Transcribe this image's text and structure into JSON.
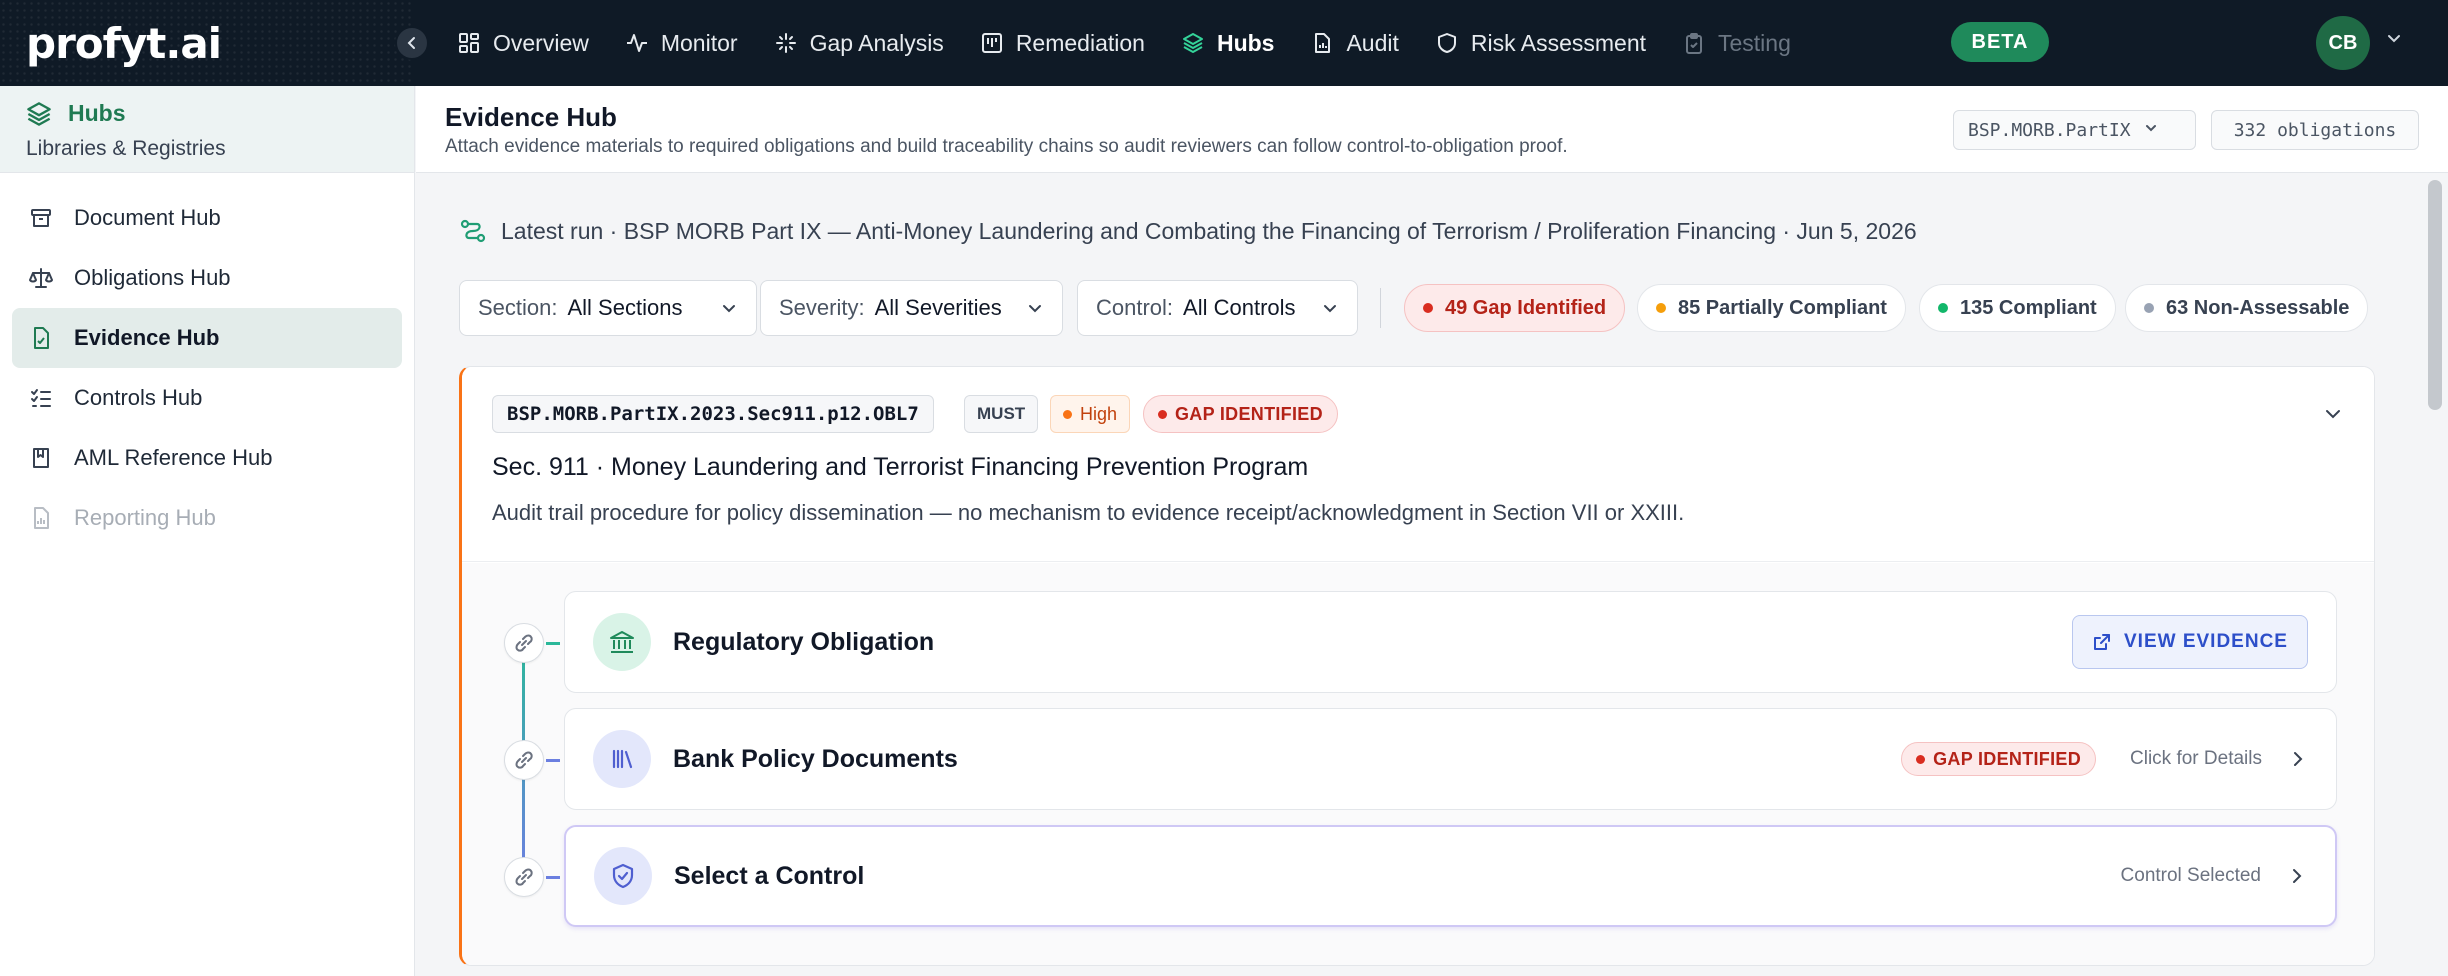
{
  "app": {
    "logo": "profyt.ai",
    "beta_label": "BETA",
    "avatar_initials": "CB"
  },
  "nav": {
    "items": [
      {
        "label": "Overview",
        "icon": "grid-icon"
      },
      {
        "label": "Monitor",
        "icon": "pulse-icon"
      },
      {
        "label": "Gap Analysis",
        "icon": "sparkle-icon"
      },
      {
        "label": "Remediation",
        "icon": "board-icon"
      },
      {
        "label": "Hubs",
        "icon": "layers-icon"
      },
      {
        "label": "Audit",
        "icon": "file-chart-icon"
      },
      {
        "label": "Risk Assessment",
        "icon": "shield-icon"
      },
      {
        "label": "Testing",
        "icon": "clipboard-icon"
      }
    ]
  },
  "sidebar": {
    "title": "Hubs",
    "subtitle": "Libraries & Registries",
    "items": [
      {
        "label": "Document Hub",
        "icon": "archive-icon"
      },
      {
        "label": "Obligations Hub",
        "icon": "scale-icon"
      },
      {
        "label": "Evidence Hub",
        "icon": "file-check-icon"
      },
      {
        "label": "Controls Hub",
        "icon": "list-check-icon"
      },
      {
        "label": "AML Reference Hub",
        "icon": "book-icon"
      },
      {
        "label": "Reporting Hub",
        "icon": "report-icon"
      }
    ]
  },
  "header": {
    "title": "Evidence Hub",
    "description": "Attach evidence materials to required obligations and build traceability chains so audit reviewers can follow control-to-obligation proof.",
    "framework_select": "BSP.MORB.PartIX",
    "obligation_count": "332 obligations"
  },
  "run": {
    "text": "Latest run · BSP MORB Part IX — Anti-Money Laundering and Combating the Financing of Terrorism / Proliferation Financing · Jun 5, 2026"
  },
  "filters": {
    "section": {
      "label": "Section:",
      "value": "All Sections"
    },
    "severity": {
      "label": "Severity:",
      "value": "All Severities"
    },
    "control": {
      "label": "Control:",
      "value": "All Controls"
    }
  },
  "status_pills": [
    {
      "label": "49 Gap Identified",
      "color": "#d92d20"
    },
    {
      "label": "85 Partially Compliant",
      "color": "#f59e0b"
    },
    {
      "label": "135 Compliant",
      "color": "#12b76a"
    },
    {
      "label": "63 Non-Assessable",
      "color": "#98a2b3"
    }
  ],
  "card": {
    "code": "BSP.MORB.PartIX.2023.Sec911.p12.OBL7",
    "requirement": "MUST",
    "severity": "High",
    "status": "GAP IDENTIFIED",
    "title": "Sec. 911 · Money Laundering and Terrorist Financing Prevention Program",
    "description": "Audit trail procedure for policy dissemination — no mechanism to evidence receipt/acknowledgment in Section VII or XXIII.",
    "chain": [
      {
        "label": "Regulatory Obligation",
        "action": "VIEW EVIDENCE",
        "icon": "bank-icon"
      },
      {
        "label": "Bank Policy Documents",
        "status": "GAP IDENTIFIED",
        "hint": "Click for Details",
        "icon": "library-icon"
      },
      {
        "label": "Select a Control",
        "hint": "Control Selected",
        "icon": "shield-check-icon"
      }
    ]
  },
  "colors": {
    "accent": "#1f7a52",
    "topbar": "#0f1a26",
    "gap": "#b42318",
    "high": "#c2410c",
    "card_border": "#f97316"
  }
}
